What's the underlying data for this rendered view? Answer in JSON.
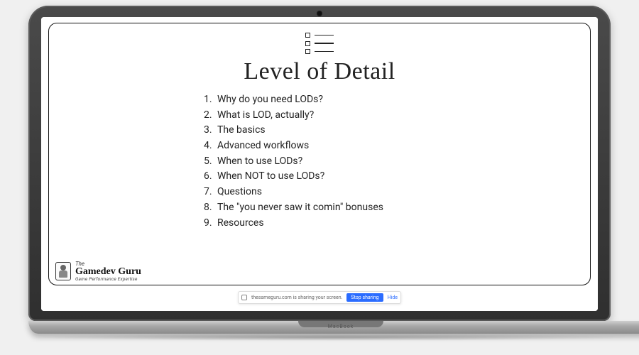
{
  "device": {
    "brand_label": "MacBook"
  },
  "slide": {
    "title": "Level of Detail",
    "agenda": [
      "Why do you need LODs?",
      "What is LOD, actually?",
      "The basics",
      "Advanced workflows",
      "When to use LODs?",
      "When NOT to use LODs?",
      "Questions",
      "The \"you never saw it comin\" bonuses",
      "Resources"
    ]
  },
  "logo": {
    "prefix": "The",
    "name": "Gamedev Guru",
    "tagline": "Game Performance Expertise"
  },
  "share_bar": {
    "status": "thesameguru.com is sharing your screen.",
    "stop_label": "Stop sharing",
    "hide_label": "Hide"
  }
}
